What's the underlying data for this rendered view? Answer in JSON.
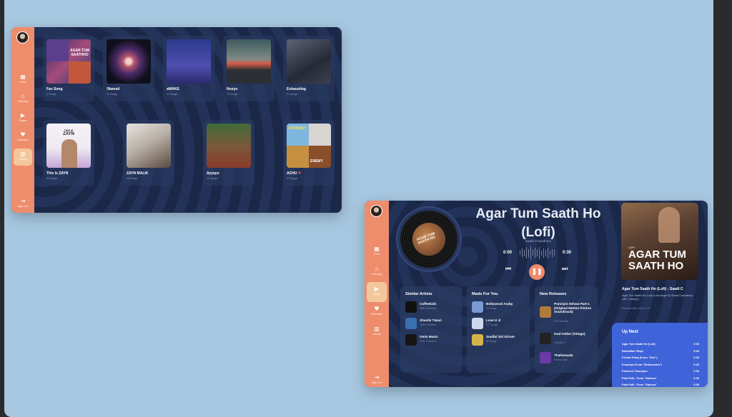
{
  "library_window": {
    "nav": [
      {
        "icon": "home-icon",
        "glyph": "▦",
        "label": "Feed"
      },
      {
        "icon": "fire-icon",
        "glyph": "♨",
        "label": "Trending"
      },
      {
        "icon": "play-icon",
        "glyph": "▶",
        "label": "Player"
      },
      {
        "icon": "heart-icon",
        "glyph": "♥",
        "label": "Favorites"
      },
      {
        "icon": "library-icon",
        "glyph": "▥",
        "label": "Library"
      }
    ],
    "signout": {
      "glyph": "⇥",
      "label": "Sign Out"
    },
    "playlists": [
      {
        "title": "Fav Song",
        "sub": "0 Songs"
      },
      {
        "title": "!Named",
        "sub": "16 Songs"
      },
      {
        "title": "aWAKE",
        "sub": "11 Songs"
      },
      {
        "title": "Nosyo",
        "sub": "12 Songs"
      },
      {
        "title": "Exhausting",
        "sub": "31 Songs"
      },
      {
        "title": "This Is ZAYN",
        "sub": "50 Songs",
        "art_top": "THIS IS",
        "art_name": "ZAYN"
      },
      {
        "title": "ZAYN MALIK",
        "sub": "48 Songs"
      },
      {
        "title": "Ayyayo",
        "sub": "12 Songs"
      },
      {
        "title": "ACHU",
        "heart": "♥",
        "sub": "47 Songs"
      }
    ],
    "art_text": {
      "fav": "AGAR TUM SAATHHO",
      "achu_top": "CRYBABY",
      "achu_bottom": "ENEMY"
    }
  },
  "player_window": {
    "nav": [
      {
        "icon": "home-icon",
        "glyph": "▦",
        "label": "Feed"
      },
      {
        "icon": "fire-icon",
        "glyph": "♨",
        "label": "Trending"
      },
      {
        "icon": "play-icon",
        "glyph": "▶",
        "label": "Player"
      },
      {
        "icon": "heart-icon",
        "glyph": "♥",
        "label": "Favorites"
      },
      {
        "icon": "library-icon",
        "glyph": "▥",
        "label": "Library"
      }
    ],
    "signout": {
      "glyph": "⇥",
      "label": "Sign Out"
    },
    "vinyl_label": "AGAR TUM SAATH HO",
    "song": {
      "title": "Agar Tum Saath Ho (Lofi)",
      "artist": "Saadi Chowdhury",
      "elapsed": "0:00",
      "duration": "0:30"
    },
    "controls": {
      "prev": "⏮",
      "pause": "❚❚",
      "next": "⏭"
    },
    "now_playing": {
      "cover_small": "LOFI",
      "cover_big": "AGAR TUM SAATH HO",
      "title": "Agar Tum Saath Ho (Lofi) - Saadi C",
      "desc": "Agar Tum Saath Ho (Lofi) is an single by Saadi Chowdhury with 1 track(s)",
      "date": "Release Date: 2022-03-17"
    },
    "similar_artists": {
      "heading": "Similar Artists",
      "items": [
        {
          "name": "Coffeekids",
          "sub": "388K Followers",
          "color": "#111111"
        },
        {
          "name": "Shashk Tiwari",
          "sub": "129K Followers",
          "color": "#3a6fb0"
        },
        {
          "name": "Omix Music",
          "sub": "225K Followers",
          "color": "#151515"
        }
      ]
    },
    "made_for_you": {
      "heading": "Made For You",
      "items": [
        {
          "name": "Bollywood Araby",
          "sub": "30 Songs",
          "color": "#7a9ad6"
        },
        {
          "name": "Love U Ji",
          "sub": "177 Songs",
          "color": "#cfd7ea"
        },
        {
          "name": "Soulful Sid Sriram",
          "sub": "50 Songs",
          "color": "#d6b24a"
        }
      ]
    },
    "new_releases": {
      "heading": "New Releases",
      "items": [
        {
          "name": "Ponniyin Selvan Part-1 (Original Motion Picture Soundtrack)",
          "sub": "A.R. Rahman",
          "color": "#b07a3a"
        },
        {
          "name": "God Father (Telugu)",
          "sub": "Thaman S",
          "color": "#222222"
        },
        {
          "name": "Thallumaala",
          "sub": "Vishnu Vijay",
          "color": "#6a3aa8"
        }
      ]
    },
    "up_next": {
      "heading": "Up Next",
      "items": [
        {
          "name": "Agar Tum Saath Ho (Lofi)",
          "dur": "0:30"
        },
        {
          "name": "Bimbilikki Pilapi",
          "dur": "0:30"
        },
        {
          "name": "Private Party (From \"Don\")",
          "dur": "0:30"
        },
        {
          "name": "Kesariya (From \"Brahmastra\")",
          "dur": "0:30"
        },
        {
          "name": "Pancheri Thaniyam",
          "dur": "0:30"
        },
        {
          "name": "Pala Palli - From \"Kaduva\"",
          "dur": "0:30"
        },
        {
          "name": "Pala Palli - From \"Kaduva\"",
          "dur": "0:30"
        }
      ]
    }
  }
}
